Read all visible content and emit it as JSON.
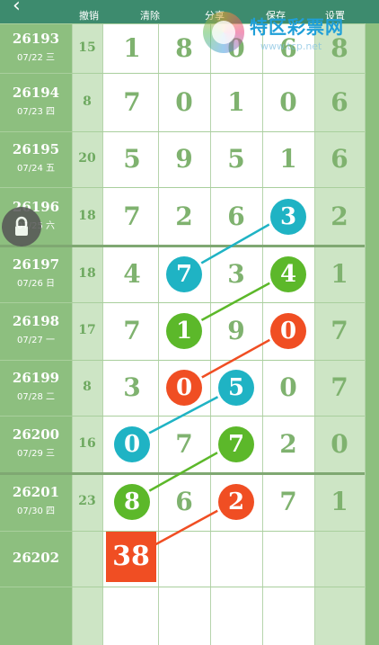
{
  "toolbar": {
    "undo": "撤销",
    "clear": "清除",
    "share": "分享",
    "save": "保存",
    "settings": "设置"
  },
  "watermark": {
    "name": "特区彩票网",
    "url": "www.tcp.net"
  },
  "rows": [
    {
      "issue": "26193",
      "date": "07/22 三",
      "sum": "15",
      "digits": [
        "1",
        "8",
        "0",
        "6"
      ],
      "right": "8"
    },
    {
      "issue": "26194",
      "date": "07/23 四",
      "sum": "8",
      "digits": [
        "7",
        "0",
        "1",
        "0"
      ],
      "right": "6"
    },
    {
      "issue": "26195",
      "date": "07/24 五",
      "sum": "20",
      "digits": [
        "5",
        "9",
        "5",
        "1"
      ],
      "right": "6"
    },
    {
      "issue": "26196",
      "date": "07/25 六",
      "sum": "18",
      "digits": [
        "7",
        "2",
        "6",
        "3"
      ],
      "right": "2"
    },
    {
      "issue": "26197",
      "date": "07/26 日",
      "sum": "18",
      "digits": [
        "4",
        "7",
        "3",
        "4"
      ],
      "right": "1"
    },
    {
      "issue": "26198",
      "date": "07/27 一",
      "sum": "17",
      "digits": [
        "7",
        "1",
        "9",
        "0"
      ],
      "right": "7"
    },
    {
      "issue": "26199",
      "date": "07/28 二",
      "sum": "8",
      "digits": [
        "3",
        "0",
        "5",
        "0"
      ],
      "right": "7"
    },
    {
      "issue": "26200",
      "date": "07/29 三",
      "sum": "16",
      "digits": [
        "0",
        "7",
        "7",
        "2"
      ],
      "right": "0"
    },
    {
      "issue": "26201",
      "date": "07/30 四",
      "sum": "23",
      "digits": [
        "8",
        "6",
        "2",
        "7"
      ],
      "right": "1"
    },
    {
      "issue": "26202",
      "date": "",
      "sum": "",
      "digits": [
        "",
        "",
        "",
        ""
      ],
      "right": ""
    }
  ],
  "prediction": "38",
  "colors": {
    "teal": "#1fb3c4",
    "green": "#5cb82a",
    "orange": "#f04e23"
  }
}
